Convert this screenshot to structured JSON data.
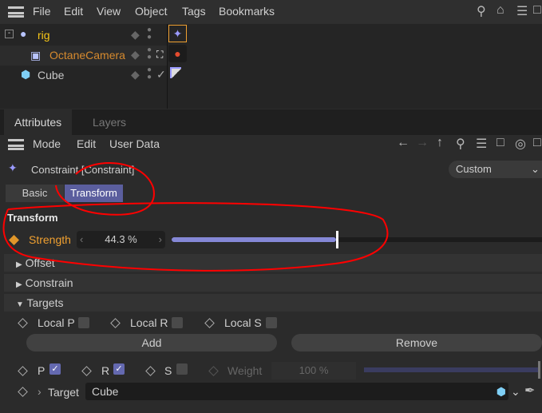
{
  "menubar": {
    "items": [
      "File",
      "Edit",
      "View",
      "Object",
      "Tags",
      "Bookmarks"
    ]
  },
  "objects": [
    {
      "name": "rig",
      "color": "#f5c518"
    },
    {
      "name": "OctaneCamera",
      "color": "#d68a2e"
    },
    {
      "name": "Cube",
      "color": "#c8c8c8"
    }
  ],
  "tabs": {
    "attributes": "Attributes",
    "layers": "Layers"
  },
  "attr_menu": {
    "mode": "Mode",
    "edit": "Edit",
    "user_data": "User Data"
  },
  "object_title": "Constraint [Constraint]",
  "preset": "Custom",
  "subtabs": {
    "basic": "Basic",
    "transform": "Transform"
  },
  "transform": {
    "heading": "Transform",
    "strength_label": "Strength",
    "strength_value": "44.3 %",
    "strength_fraction": 0.443
  },
  "sections": {
    "offset": "Offset",
    "constrain": "Constrain",
    "targets": "Targets"
  },
  "targets": {
    "local_p": "Local P",
    "local_r": "Local R",
    "local_s": "Local S",
    "add": "Add",
    "remove": "Remove",
    "p": "P",
    "r": "R",
    "s": "S",
    "p_checked": true,
    "r_checked": true,
    "s_checked": false,
    "weight_label": "Weight",
    "weight_value": "100 %",
    "target_label": "Target",
    "target_value": "Cube"
  },
  "colors": {
    "accent": "#6469b0",
    "slider": "#8588d6",
    "highlight": "#f0a030",
    "annotation": "#ff0000"
  }
}
